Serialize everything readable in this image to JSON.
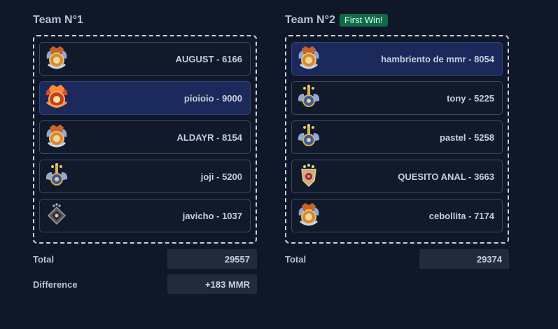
{
  "team1": {
    "title": "Team N°1",
    "players": [
      {
        "label": "AUGUST - 6166",
        "medal": "divine-medal-icon",
        "selected": false
      },
      {
        "label": "pioioio - 9000",
        "medal": "immortal-medal-icon",
        "selected": true
      },
      {
        "label": "ALDAYR - 8154",
        "medal": "divine-medal-icon",
        "selected": false
      },
      {
        "label": "joji - 5200",
        "medal": "ancient-medal-icon",
        "selected": false
      },
      {
        "label": "javicho - 1037",
        "medal": "herald-medal-icon",
        "selected": false
      }
    ],
    "total_label": "Total",
    "total_value": "29557",
    "difference_label": "Difference",
    "difference_value": "+183 MMR"
  },
  "team2": {
    "title": "Team N°2",
    "badge": "First Win!",
    "players": [
      {
        "label": "hambriento de mmr - 8054",
        "medal": "divine-medal-icon",
        "selected": true
      },
      {
        "label": "tony - 5225",
        "medal": "ancient-medal-icon",
        "selected": false
      },
      {
        "label": "pastel - 5258",
        "medal": "ancient-medal-icon",
        "selected": false
      },
      {
        "label": "QUESITO ANAL - 3663",
        "medal": "crusader-medal-icon",
        "selected": false
      },
      {
        "label": "cebollita - 7174",
        "medal": "divine-medal-icon",
        "selected": false
      }
    ],
    "total_label": "Total",
    "total_value": "29374"
  },
  "colors": {
    "background": "#0f1728",
    "selected_row": "#1b2a5b",
    "badge": "#0e6b45"
  }
}
